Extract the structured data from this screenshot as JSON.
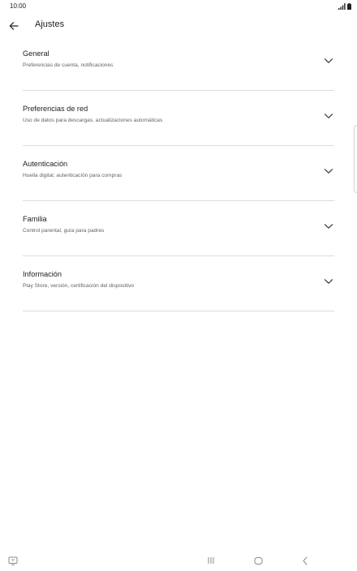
{
  "status_bar": {
    "time": "10:00",
    "icons": [
      "signal-icon",
      "battery-icon"
    ]
  },
  "app_bar": {
    "back_icon": "arrow-back-icon",
    "title": "Ajustes"
  },
  "settings": [
    {
      "title": "General",
      "subtitle": "Preferencias de cuenta, notificaciones"
    },
    {
      "title": "Preferencias de red",
      "subtitle": "Uso de datos para descargas, actualizaciones automáticas"
    },
    {
      "title": "Autenticación",
      "subtitle": "Huella digital, autenticación para compras"
    },
    {
      "title": "Familia",
      "subtitle": "Control parental, guía para padres"
    },
    {
      "title": "Información",
      "subtitle": "Play Store, versión, certificación del dispositivo"
    }
  ],
  "nav_bar": {
    "icons": [
      "screenshot-icon",
      "recents-icon",
      "home-icon",
      "back-nav-icon"
    ]
  },
  "colors": {
    "text_primary": "#202124",
    "text_secondary": "#5f6368",
    "divider": "#dadce0",
    "nav_icon": "#8a8a8a"
  }
}
